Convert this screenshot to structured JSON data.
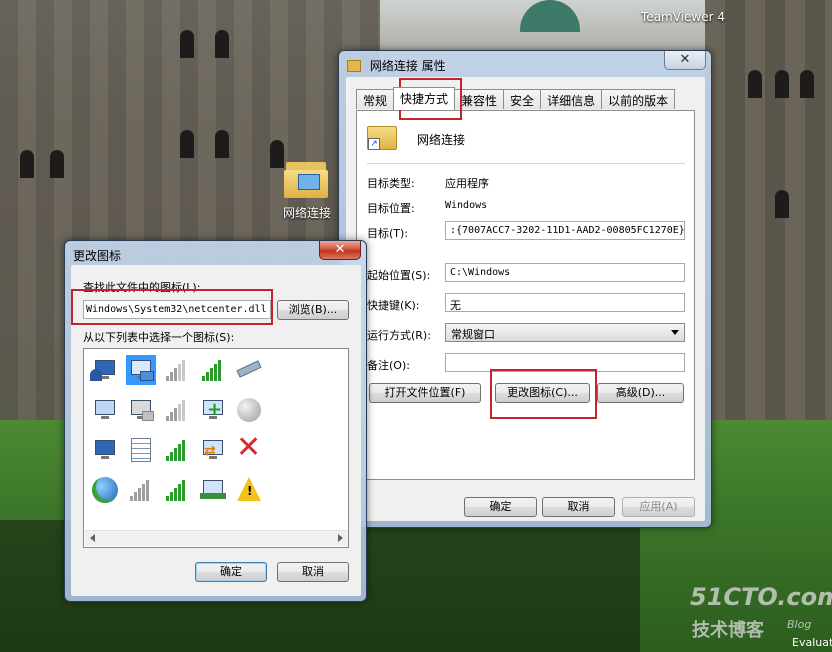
{
  "desktop": {
    "icons": [
      {
        "label": "网络连接"
      },
      {
        "label": "TeamViewer 4"
      }
    ],
    "watermark": {
      "line1": "51CTO.com",
      "line2": "技术博客",
      "line3": "Blog",
      "corner": "Evaluat"
    }
  },
  "properties_dialog": {
    "title": "网络连接 属性",
    "close_glyph": "✕",
    "tabs": [
      "常规",
      "快捷方式",
      "兼容性",
      "安全",
      "详细信息",
      "以前的版本"
    ],
    "active_tab": "快捷方式",
    "shortcut_name": "网络连接",
    "target_type_label": "目标类型:",
    "target_type_value": "应用程序",
    "target_location_label": "目标位置:",
    "target_location_value": "Windows",
    "target_label": "目标(T):",
    "target_value": ":{7007ACC7-3202-11D1-AAD2-00805FC1270E}",
    "start_in_label": "起始位置(S):",
    "start_in_value": "C:\\Windows",
    "shortcut_key_label": "快捷键(K):",
    "shortcut_key_value": "无",
    "run_label": "运行方式(R):",
    "run_value": "常规窗口",
    "comment_label": "备注(O):",
    "comment_value": "",
    "open_location_button": "打开文件位置(F)",
    "change_icon_button": "更改图标(C)...",
    "advanced_button": "高级(D)...",
    "ok_button": "确定",
    "cancel_button": "取消",
    "apply_button": "应用(A)"
  },
  "change_icon_dialog": {
    "title": "更改图标",
    "close_glyph": "✕",
    "file_label": "查找此文件中的图标(L):",
    "file_value": "Windows\\System32\\netcenter.dll",
    "browse_button": "浏览(B)...",
    "list_label": "从以下列表中选择一个图标(S):",
    "icons": [
      "network-users-icon",
      "network-computer-icon",
      "signal-bars-icon",
      "signal-bars-green-icon",
      "ethernet-cable-icon",
      "computer-monitor-icon",
      "network-disconnected-icon",
      "signal-bars-icon",
      "network-add-icon",
      "globe-gray-icon",
      "computer-network-icon",
      "checklist-icon",
      "signal-bars-green-icon",
      "network-transfer-icon",
      "red-x-icon",
      "globe-icon",
      "signal-bars-gray-icon",
      "signal-bars-green-icon",
      "network-adapter-icon",
      "warning-icon"
    ],
    "selected_index": 1,
    "ok_button": "确定",
    "cancel_button": "取消"
  },
  "colors": {
    "highlight": "#c3262a",
    "selection": "#3399ff"
  }
}
